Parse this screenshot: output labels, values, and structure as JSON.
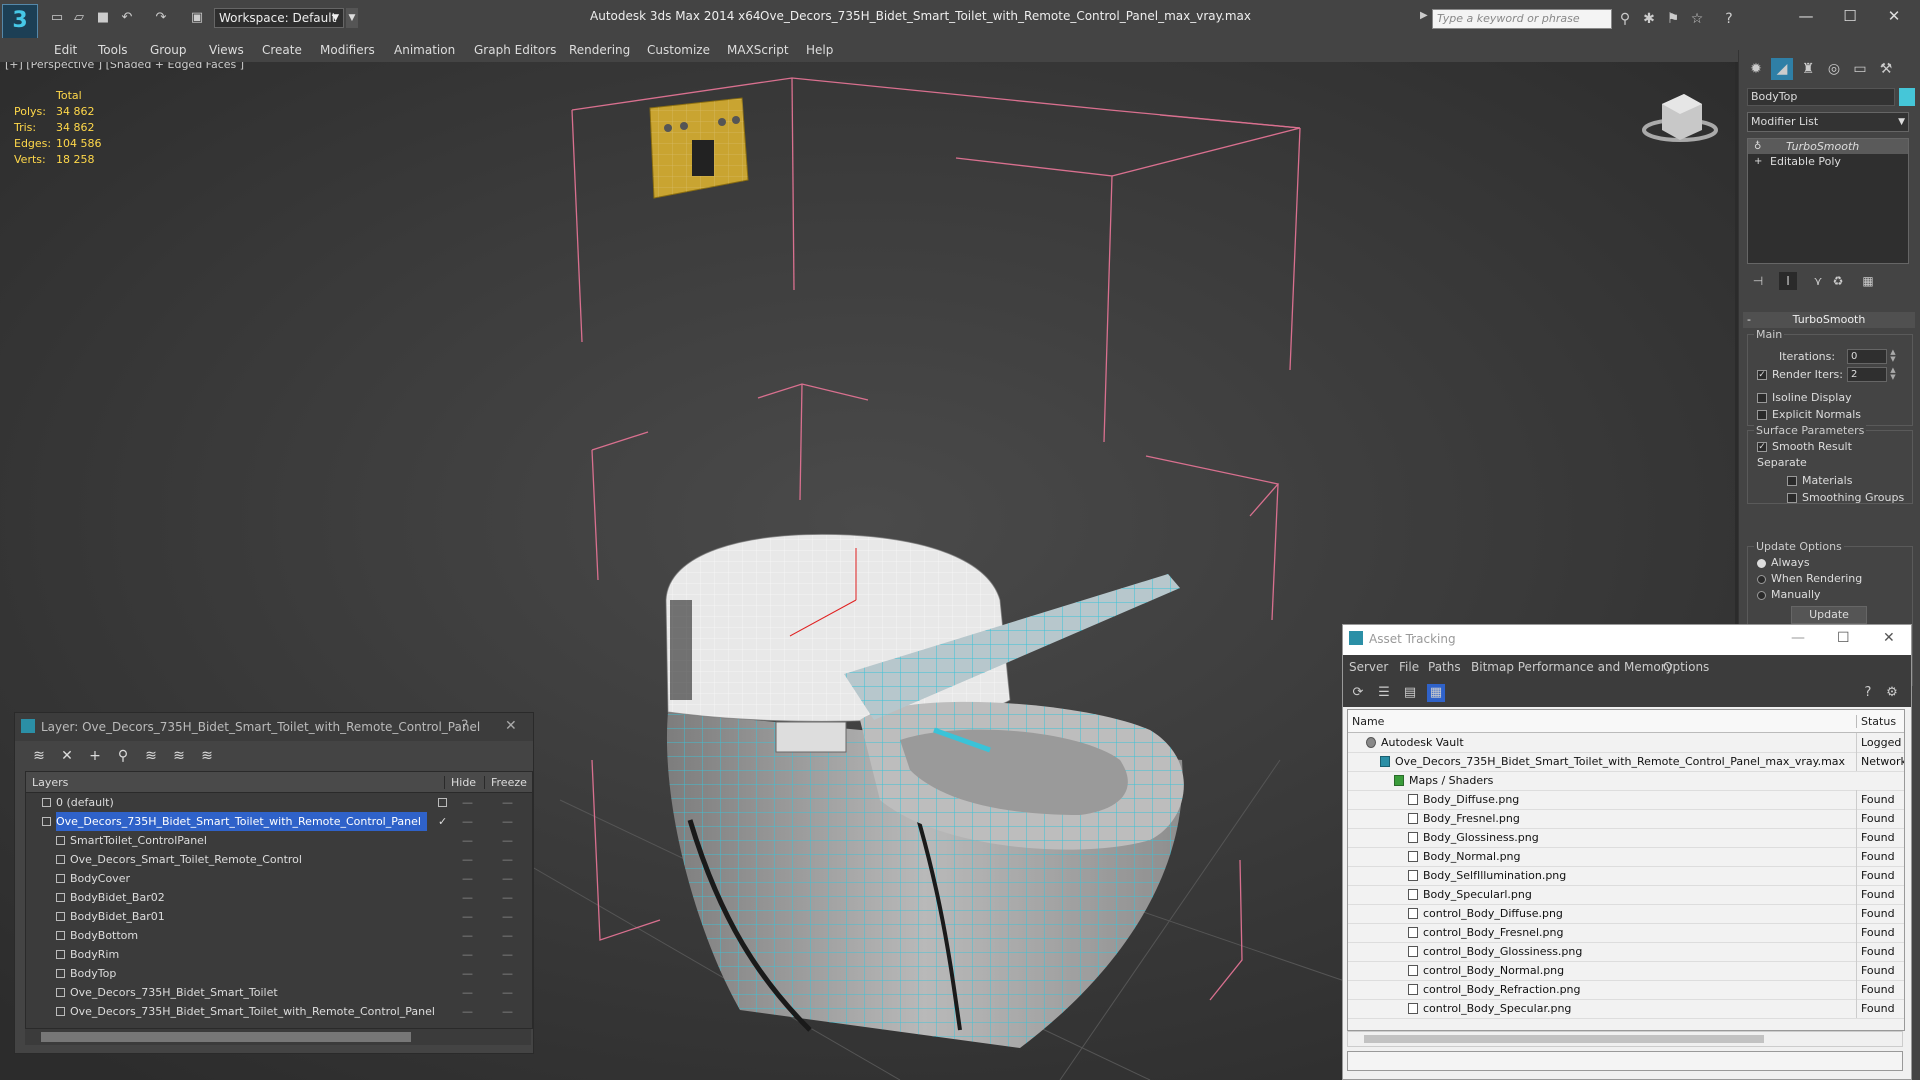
{
  "window": {
    "app_title": "Autodesk 3ds Max  2014 x64",
    "file_title": "Ove_Decors_735H_Bidet_Smart_Toilet_with_Remote_Control_Panel_max_vray.max",
    "workspace": "Workspace: Default",
    "search_placeholder": "Type a keyword or phrase",
    "minimize": "—",
    "maximize": "☐",
    "close": "✕"
  },
  "menu": [
    "Edit",
    "Tools",
    "Group",
    "Views",
    "Create",
    "Modifiers",
    "Animation",
    "Graph Editors",
    "Rendering",
    "Customize",
    "MAXScript",
    "Help"
  ],
  "viewport": {
    "label": "[+] [Perspective ] [Shaded + Edged Faces ]",
    "stats_header": "Total",
    "stats": [
      {
        "label": "Polys:",
        "value": "34 862"
      },
      {
        "label": "Tris:",
        "value": "34 862"
      },
      {
        "label": "Edges:",
        "value": "104 586"
      },
      {
        "label": "Verts:",
        "value": "18 258"
      }
    ],
    "colors": {
      "bbox": "#d9708f",
      "wire": "#3ac3d8",
      "object": "#9a9a9a",
      "panel_obj": "#c9a431"
    }
  },
  "command_panel": {
    "object_name": "BodyTop",
    "object_color": "#45c6d8",
    "modifier_list": "Modifier List",
    "stack": [
      "TurboSmooth",
      "Editable Poly"
    ],
    "rollout_title": "TurboSmooth",
    "main_label": "Main",
    "iterations_label": "Iterations:",
    "iterations_value": "0",
    "render_iters_label": "Render Iters:",
    "render_iters_value": "2",
    "isoline_display": "Isoline Display",
    "explicit_normals": "Explicit Normals",
    "surface_params_label": "Surface Parameters",
    "smooth_result": "Smooth Result",
    "separate_label": "Separate",
    "materials": "Materials",
    "smoothing_groups": "Smoothing Groups",
    "update_options_label": "Update Options",
    "always": "Always",
    "when_rendering": "When Rendering",
    "manually": "Manually",
    "update_button": "Update"
  },
  "layer_panel": {
    "title": "Layer: Ove_Decors_735H_Bidet_Smart_Toilet_with_Remote_Control_Panel",
    "help": "?",
    "close": "✕",
    "col_layers": "Layers",
    "col_hide": "Hide",
    "col_freeze": "Freeze",
    "rows": [
      {
        "name": "0 (default)",
        "indent": 1
      },
      {
        "name": "Ove_Decors_735H_Bidet_Smart_Toilet_with_Remote_Control_Panel",
        "indent": 1
      },
      {
        "name": "SmartToilet_ControlPanel",
        "indent": 2
      },
      {
        "name": "Ove_Decors_Smart_Toilet_Remote_Control",
        "indent": 2
      },
      {
        "name": "BodyCover",
        "indent": 2
      },
      {
        "name": "BodyBidet_Bar02",
        "indent": 2
      },
      {
        "name": "BodyBidet_Bar01",
        "indent": 2
      },
      {
        "name": "BodyBottom",
        "indent": 2
      },
      {
        "name": "BodyRim",
        "indent": 2
      },
      {
        "name": "BodyTop",
        "indent": 2
      },
      {
        "name": "Ove_Decors_735H_Bidet_Smart_Toilet",
        "indent": 2
      },
      {
        "name": "Ove_Decors_735H_Bidet_Smart_Toilet_with_Remote_Control_Panel",
        "indent": 2
      }
    ]
  },
  "asset_panel": {
    "title": "Asset Tracking",
    "minimize": "—",
    "maximize": "☐",
    "close": "✕",
    "menu": [
      "Server",
      "File",
      "Paths",
      "Bitmap Performance and Memory",
      "Options"
    ],
    "col_name": "Name",
    "col_status": "Status",
    "rows": [
      {
        "name": "Autodesk Vault",
        "status": "Logged Ou",
        "indent": 1
      },
      {
        "name": "Ove_Decors_735H_Bidet_Smart_Toilet_with_Remote_Control_Panel_max_vray.max",
        "status": "Network P",
        "indent": 2
      },
      {
        "name": "Maps / Shaders",
        "status": "",
        "indent": 3
      },
      {
        "name": "Body_Diffuse.png",
        "status": "Found",
        "indent": 4
      },
      {
        "name": "Body_Fresnel.png",
        "status": "Found",
        "indent": 4
      },
      {
        "name": "Body_Glossiness.png",
        "status": "Found",
        "indent": 4
      },
      {
        "name": "Body_Normal.png",
        "status": "Found",
        "indent": 4
      },
      {
        "name": "Body_SelfIllumination.png",
        "status": "Found",
        "indent": 4
      },
      {
        "name": "Body_Specularl.png",
        "status": "Found",
        "indent": 4
      },
      {
        "name": "control_Body_Diffuse.png",
        "status": "Found",
        "indent": 4
      },
      {
        "name": "control_Body_Fresnel.png",
        "status": "Found",
        "indent": 4
      },
      {
        "name": "control_Body_Glossiness.png",
        "status": "Found",
        "indent": 4
      },
      {
        "name": "control_Body_Normal.png",
        "status": "Found",
        "indent": 4
      },
      {
        "name": "control_Body_Refraction.png",
        "status": "Found",
        "indent": 4
      },
      {
        "name": "control_Body_Specular.png",
        "status": "Found",
        "indent": 4
      }
    ]
  }
}
